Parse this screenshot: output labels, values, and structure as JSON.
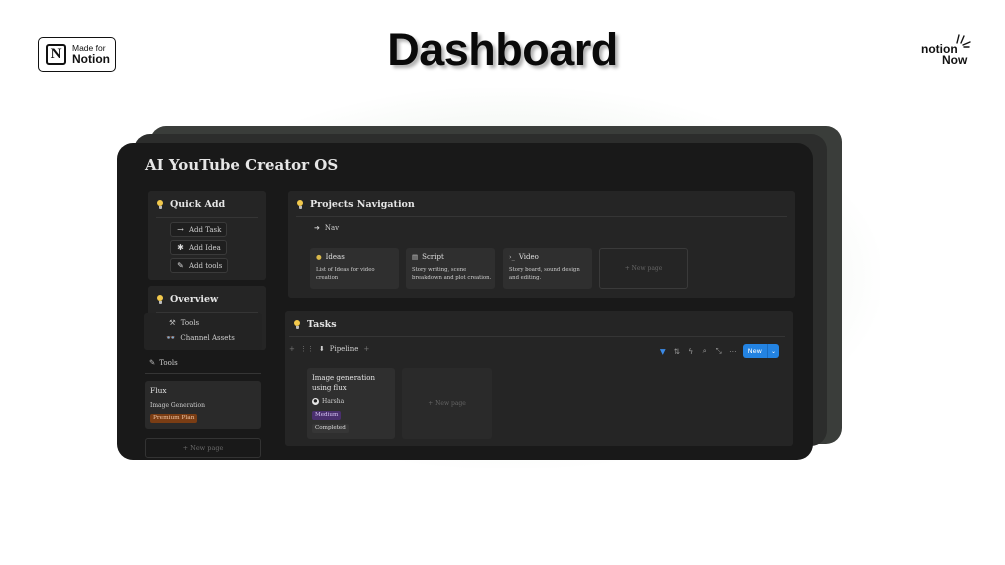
{
  "header": {
    "badge": {
      "small": "Made for",
      "big": "Notion"
    },
    "title": "Dashboard",
    "brand": {
      "line1": "notion",
      "line2": "Now"
    }
  },
  "app": {
    "title": "AI YouTube Creator OS",
    "quick_add": {
      "title": "Quick Add",
      "buttons": [
        {
          "icon": "arrow-right-icon",
          "label": "Add Task"
        },
        {
          "icon": "asterisk-icon",
          "label": "Add Idea"
        },
        {
          "icon": "wrench-icon",
          "label": "Add tools"
        }
      ]
    },
    "overview": {
      "title": "Overview",
      "items": [
        {
          "icon": "tools-icon",
          "label": "Tools"
        },
        {
          "icon": "glasses-icon",
          "label": "Channel Assets"
        }
      ]
    },
    "tools_section": {
      "label": "Tools",
      "card": {
        "name": "Flux",
        "subtitle": "Image Generation",
        "tag": "Premium Plan"
      },
      "new_page": "New page"
    },
    "projects": {
      "title": "Projects Navigation",
      "nav_label": "Nav",
      "cards": [
        {
          "icon": "bulb-icon",
          "title": "Ideas",
          "desc": "List of Ideas for video creation"
        },
        {
          "icon": "document-icon",
          "title": "Script",
          "desc": "Story writing, scene breakdown and plot creation."
        },
        {
          "icon": "terminal-icon",
          "title": "Video",
          "desc": "Story board, sound design and editing."
        }
      ],
      "new_page": "New page"
    },
    "tasks": {
      "title": "Tasks",
      "view_label": "Pipeline",
      "new_button": "New",
      "card": {
        "title": "Image generation using flux",
        "assignee": "Harsha",
        "priority": "Medium",
        "status": "Completed"
      },
      "new_page": "New page"
    }
  },
  "colors": {
    "screen_bg": "#191919",
    "panel_bg": "#252525",
    "accent_blue": "#2383e2",
    "premium_tag": "#7a3d14",
    "medium_tag": "#4a2f6e"
  }
}
